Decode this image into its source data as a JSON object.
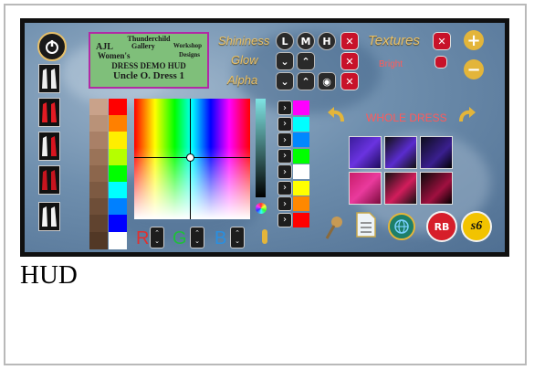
{
  "caption": "HUD",
  "logo": {
    "line1": "Thunderchild",
    "line2": "Gallery",
    "line3": "AJL",
    "line4": "Workshop",
    "line5": "Women's",
    "line6": "Designs",
    "line7": "DRESS DEMO HUD",
    "line8": "Uncle O. Dress 1"
  },
  "controls": {
    "shininess_label": "Shininess",
    "shininess_options": [
      "L",
      "M",
      "H"
    ],
    "glow_label": "Glow",
    "alpha_label": "Alpha",
    "textures_label": "Textures",
    "bright_label": "Bright",
    "whole_dress_label": "WHOLE DRESS",
    "rgb_labels": [
      "R",
      "G",
      "B"
    ]
  },
  "icons": {
    "power": "power-icon",
    "close": "x",
    "up": "chevron-up",
    "down": "chevron-down",
    "eye": "eye-icon",
    "plus": "plus-icon",
    "minus": "minus-icon",
    "undo": "curved-arrow-left",
    "redo": "curved-arrow-right",
    "pushpin": "pushpin-icon",
    "notecard": "notecard-icon",
    "globe": "globe-icon",
    "rb": "RB",
    "s6": "s6"
  },
  "badges": {
    "rb_label": "RB",
    "s6_label": "s6"
  },
  "colors": {
    "accent_gold": "#e7c06a",
    "close_red": "#c8122a",
    "texture_label": "#ff5a5a"
  },
  "left_swatches": [
    "#c9a28a",
    "#b99278",
    "#a98067",
    "#9a7358",
    "#8c664c",
    "#7d5a42",
    "#6e4e38",
    "#60432f",
    "#523826"
  ],
  "right_swatches": [
    "#ff0000",
    "#ff8000",
    "#ffee00",
    "#b5ff00",
    "#00ff00",
    "#00ffff",
    "#0080ff",
    "#0000ff",
    "#ffffff"
  ],
  "preset_swatches": [
    "#ff00ff",
    "#00ffff",
    "#0088ff",
    "#00ff00",
    "#ffffff",
    "#ffff00",
    "#ff8800",
    "#ff0000"
  ]
}
